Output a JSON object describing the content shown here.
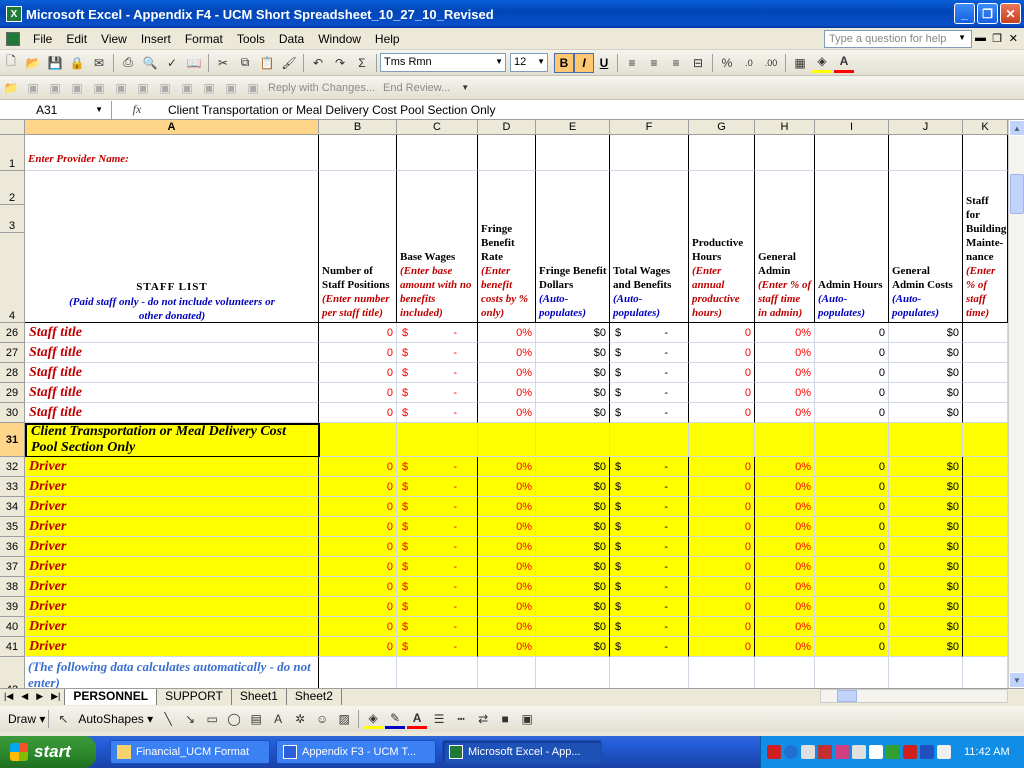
{
  "window": {
    "title": "Microsoft Excel - Appendix F4 - UCM Short Spreadsheet_10_27_10_Revised"
  },
  "menu": {
    "items": [
      "File",
      "Edit",
      "View",
      "Insert",
      "Format",
      "Tools",
      "Data",
      "Window",
      "Help"
    ],
    "help_placeholder": "Type a question for help"
  },
  "toolbar": {
    "font": "Tms Rmn",
    "size": "12",
    "reply_label": "Reply with Changes...",
    "end_review_label": "End Review..."
  },
  "formula_bar": {
    "name_box": "A31",
    "fx": "fx",
    "content": "Client Transportation or Meal Delivery Cost Pool Section Only"
  },
  "columns": [
    "A",
    "B",
    "C",
    "D",
    "E",
    "F",
    "G",
    "H",
    "I",
    "J",
    "K"
  ],
  "header_rows": [
    "1",
    "2",
    "3",
    "4"
  ],
  "sheet": {
    "provider_label": "Enter Provider Name:",
    "staff_list_title": "STAFF LIST",
    "staff_list_sub": "(Paid staff only - do not include volunteers or other donated)",
    "col_headers": {
      "B": {
        "title": "Number of Staff Positions",
        "note": "(Enter number per staff title)"
      },
      "C": {
        "title": "Base Wages",
        "note": "(Enter base amount with no benefits included)"
      },
      "D": {
        "title": "Fringe Benefit Rate",
        "note": "(Enter benefit costs by % only)"
      },
      "E": {
        "title": "Fringe Benefit Dollars",
        "note": "(Auto-populates)"
      },
      "F": {
        "title": "Total Wages and Benefits",
        "note": "(Auto-populates)"
      },
      "G": {
        "title": "Productive Hours",
        "note": "(Enter annual productive hours)"
      },
      "H": {
        "title": "General Admin",
        "note": "(Enter % of staff time in admin)"
      },
      "I": {
        "title": "Admin Hours",
        "note": "(Auto-populates)"
      },
      "J": {
        "title": "General Admin Costs",
        "note": "(Auto-populates)"
      },
      "K": {
        "title": "Staff for Building Mainte-nance",
        "note": "(Enter % of staff time)"
      }
    },
    "section_label": "Client Transportation or Meal Delivery Cost Pool Section Only",
    "footer_note": "(The following data calculates automatically - do not enter)",
    "rows": [
      {
        "num": "26",
        "label": "Staff title",
        "b": "0",
        "c_sym": "$",
        "c": "-",
        "d": "0%",
        "e": "$0",
        "f_sym": "$",
        "f": "-",
        "g": "0",
        "h": "0%",
        "i": "0",
        "j": "$0",
        "yellow": false
      },
      {
        "num": "27",
        "label": "Staff title",
        "b": "0",
        "c_sym": "$",
        "c": "-",
        "d": "0%",
        "e": "$0",
        "f_sym": "$",
        "f": "-",
        "g": "0",
        "h": "0%",
        "i": "0",
        "j": "$0",
        "yellow": false
      },
      {
        "num": "28",
        "label": "Staff title",
        "b": "0",
        "c_sym": "$",
        "c": "-",
        "d": "0%",
        "e": "$0",
        "f_sym": "$",
        "f": "-",
        "g": "0",
        "h": "0%",
        "i": "0",
        "j": "$0",
        "yellow": false
      },
      {
        "num": "29",
        "label": "Staff title",
        "b": "0",
        "c_sym": "$",
        "c": "-",
        "d": "0%",
        "e": "$0",
        "f_sym": "$",
        "f": "-",
        "g": "0",
        "h": "0%",
        "i": "0",
        "j": "$0",
        "yellow": false
      },
      {
        "num": "30",
        "label": "Staff title",
        "b": "0",
        "c_sym": "$",
        "c": "-",
        "d": "0%",
        "e": "$0",
        "f_sym": "$",
        "f": "-",
        "g": "0",
        "h": "0%",
        "i": "0",
        "j": "$0",
        "yellow": false
      },
      {
        "num": "32",
        "label": "Driver",
        "b": "0",
        "c_sym": "$",
        "c": "-",
        "d": "0%",
        "e": "$0",
        "f_sym": "$",
        "f": "-",
        "g": "0",
        "h": "0%",
        "i": "0",
        "j": "$0",
        "yellow": true
      },
      {
        "num": "33",
        "label": "Driver",
        "b": "0",
        "c_sym": "$",
        "c": "-",
        "d": "0%",
        "e": "$0",
        "f_sym": "$",
        "f": "-",
        "g": "0",
        "h": "0%",
        "i": "0",
        "j": "$0",
        "yellow": true
      },
      {
        "num": "34",
        "label": "Driver",
        "b": "0",
        "c_sym": "$",
        "c": "-",
        "d": "0%",
        "e": "$0",
        "f_sym": "$",
        "f": "-",
        "g": "0",
        "h": "0%",
        "i": "0",
        "j": "$0",
        "yellow": true
      },
      {
        "num": "35",
        "label": "Driver",
        "b": "0",
        "c_sym": "$",
        "c": "-",
        "d": "0%",
        "e": "$0",
        "f_sym": "$",
        "f": "-",
        "g": "0",
        "h": "0%",
        "i": "0",
        "j": "$0",
        "yellow": true
      },
      {
        "num": "36",
        "label": "Driver",
        "b": "0",
        "c_sym": "$",
        "c": "-",
        "d": "0%",
        "e": "$0",
        "f_sym": "$",
        "f": "-",
        "g": "0",
        "h": "0%",
        "i": "0",
        "j": "$0",
        "yellow": true
      },
      {
        "num": "37",
        "label": "Driver",
        "b": "0",
        "c_sym": "$",
        "c": "-",
        "d": "0%",
        "e": "$0",
        "f_sym": "$",
        "f": "-",
        "g": "0",
        "h": "0%",
        "i": "0",
        "j": "$0",
        "yellow": true
      },
      {
        "num": "38",
        "label": "Driver",
        "b": "0",
        "c_sym": "$",
        "c": "-",
        "d": "0%",
        "e": "$0",
        "f_sym": "$",
        "f": "-",
        "g": "0",
        "h": "0%",
        "i": "0",
        "j": "$0",
        "yellow": true
      },
      {
        "num": "39",
        "label": "Driver",
        "b": "0",
        "c_sym": "$",
        "c": "-",
        "d": "0%",
        "e": "$0",
        "f_sym": "$",
        "f": "-",
        "g": "0",
        "h": "0%",
        "i": "0",
        "j": "$0",
        "yellow": true
      },
      {
        "num": "40",
        "label": "Driver",
        "b": "0",
        "c_sym": "$",
        "c": "-",
        "d": "0%",
        "e": "$0",
        "f_sym": "$",
        "f": "-",
        "g": "0",
        "h": "0%",
        "i": "0",
        "j": "$0",
        "yellow": true
      },
      {
        "num": "41",
        "label": "Driver",
        "b": "0",
        "c_sym": "$",
        "c": "-",
        "d": "0%",
        "e": "$0",
        "f_sym": "$",
        "f": "-",
        "g": "0",
        "h": "0%",
        "i": "0",
        "j": "$0",
        "yellow": true
      }
    ],
    "section_row_num": "31",
    "footer_row_num": "42"
  },
  "tabs": [
    "PERSONNEL",
    "SUPPORT",
    "Sheet1",
    "Sheet2"
  ],
  "active_tab": "PERSONNEL",
  "drawbar": {
    "draw_label": "Draw",
    "autoshapes_label": "AutoShapes"
  },
  "taskbar": {
    "start": "start",
    "tasks": [
      "Financial_UCM Format",
      "Appendix F3 - UCM T...",
      "Microsoft Excel - App..."
    ],
    "clock": "11:42 AM"
  },
  "colors": {
    "highlight": "#FFFF00",
    "input_red": "#FF0000",
    "note_blue": "#0000C0"
  }
}
